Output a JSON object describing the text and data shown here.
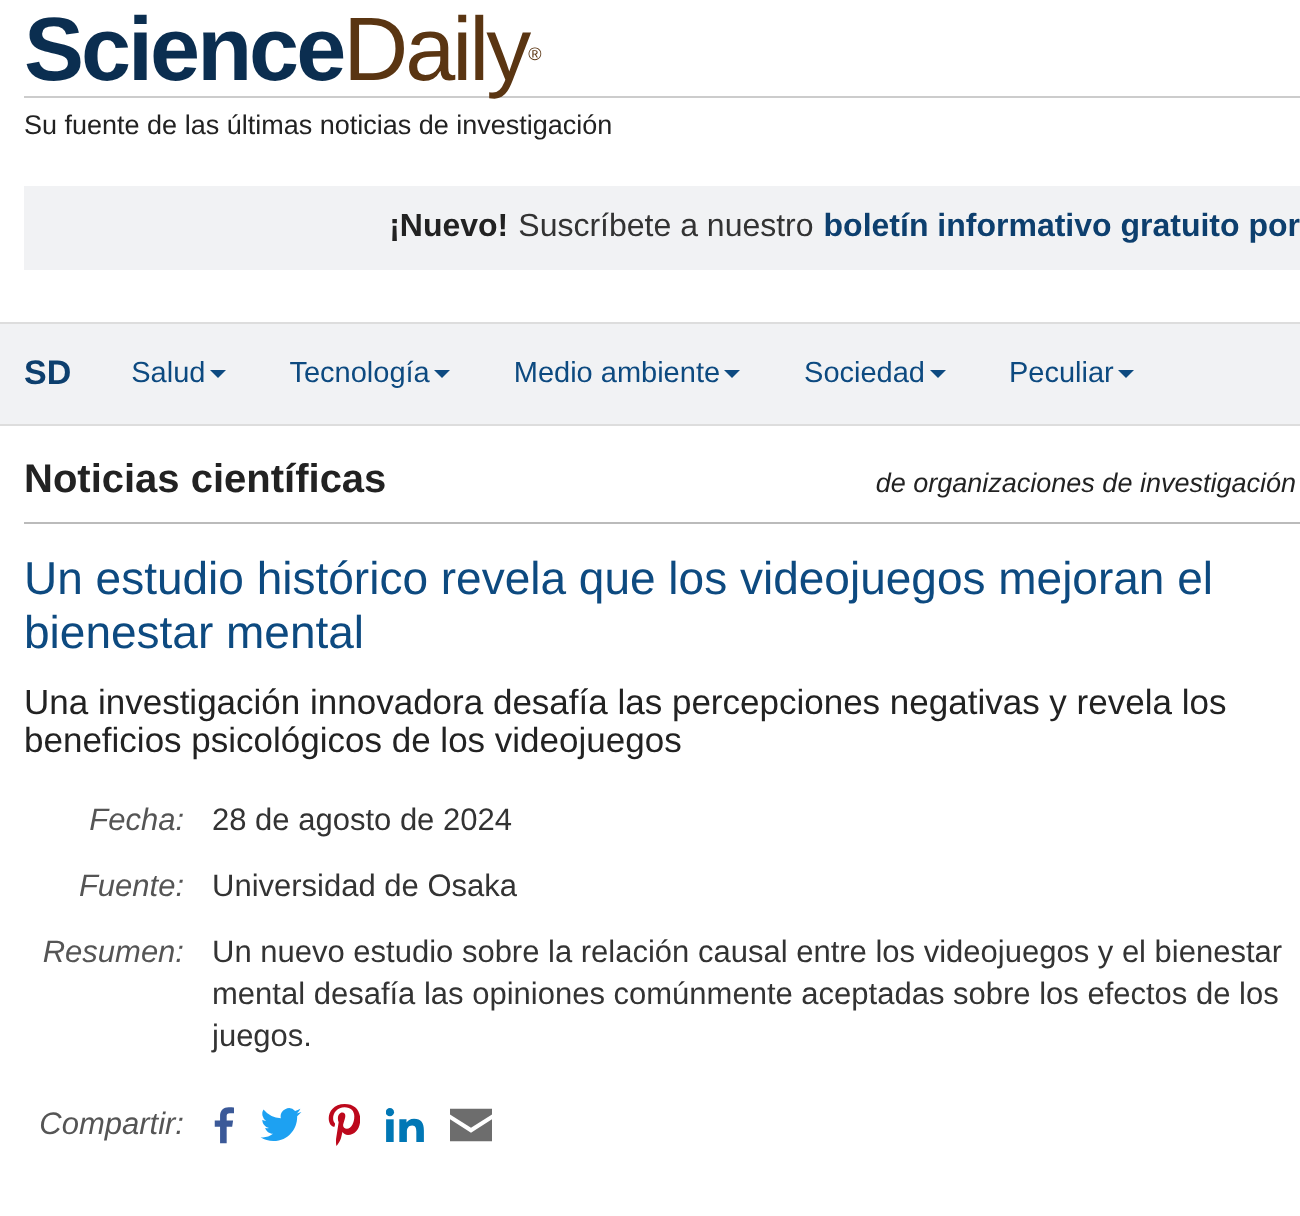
{
  "logo": {
    "part_1": "Science",
    "part_2": "Daily",
    "mark": "®"
  },
  "tagline": "Su fuente de las últimas noticias de investigación",
  "banner": {
    "lead": "¡Nuevo!",
    "text": "Suscríbete a nuestro",
    "link": "boletín informativo gratuito por"
  },
  "nav": {
    "brand": "SD",
    "items": [
      {
        "label": "Salud"
      },
      {
        "label": "Tecnología"
      },
      {
        "label": "Medio ambiente"
      },
      {
        "label": "Sociedad"
      },
      {
        "label": "Peculiar"
      }
    ]
  },
  "section": {
    "title": "Noticias científicas",
    "note": "de organizaciones de investigación"
  },
  "article": {
    "title": "Un estudio histórico revela que los videojuegos mejoran el bienestar mental",
    "subtitle": "Una investigación innovadora desafía las percepciones negativas y revela los beneficios psicológicos de los videojuegos",
    "meta": [
      {
        "label": "Fecha:",
        "value": "28 de agosto de 2024"
      },
      {
        "label": "Fuente:",
        "value": "Universidad de Osaka"
      },
      {
        "label": "Resumen:",
        "value": "Un nuevo estudio sobre la relación causal entre los videojuegos y el bienestar mental desafía las opiniones comúnmente aceptadas sobre los efectos de los juegos."
      }
    ],
    "share": {
      "label": "Compartir:",
      "services": [
        {
          "kind": "facebook"
        },
        {
          "kind": "twitter"
        },
        {
          "kind": "pinterest"
        },
        {
          "kind": "linkedin"
        },
        {
          "kind": "email"
        }
      ]
    }
  }
}
